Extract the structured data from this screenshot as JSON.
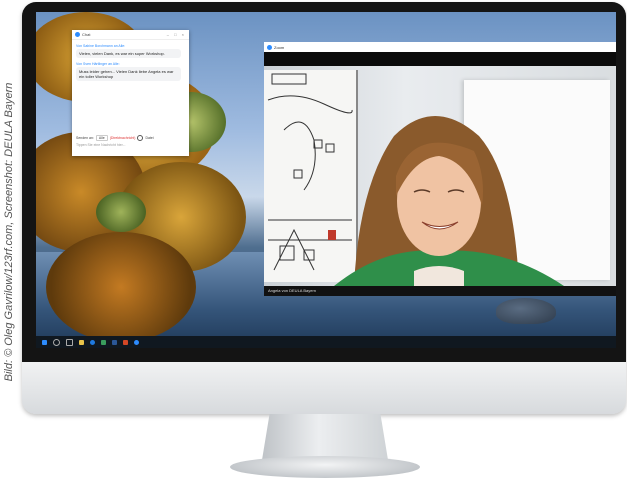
{
  "credit": "Bild: © Oleg Gavrilow/123rf.com, Screenshot: DEULA Bayern",
  "chat": {
    "title": "Chat",
    "window_buttons": "– □ ×",
    "messages": [
      {
        "header": "Von Sabine Borchmann an Alle:",
        "text": "Vielen, vielen Dank, es war ein super Workshop."
      },
      {
        "header": "Von Sven Härtlinger an Alle:",
        "text": "Muss leider gehen... Vielen Dank liebe Angela es war ein toller Workshop"
      }
    ],
    "send_label": "Senden an:",
    "recipient": "Alle",
    "privacy": "(Direktnachricht)",
    "file_label": "Datei",
    "input_placeholder": "Tippen Sie eine Nachricht hier..."
  },
  "zoom": {
    "title": "Zoom",
    "participant_name": "Angela von DEULA Bayern"
  },
  "colors": {
    "accent": "#2d8cff",
    "taskbar": "#101820"
  }
}
